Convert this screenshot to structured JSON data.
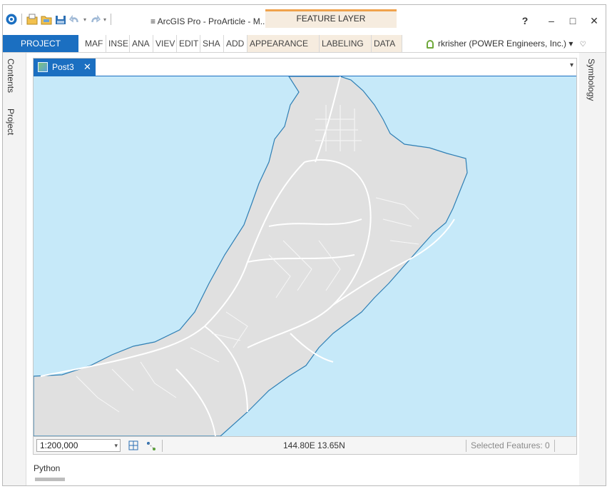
{
  "titlebar": {
    "title": "≡ ArcGIS Pro - ProArticle - M...",
    "context_tab": "FEATURE LAYER",
    "help": "?",
    "minimize": "–",
    "maximize": "□",
    "close": "✕"
  },
  "ribbon": {
    "project_tab": "PROJECT",
    "tabs": [
      "MAF",
      "INSE",
      "ANA",
      "VIEV",
      "EDIT",
      "SHA",
      "ADD"
    ],
    "context_tabs": [
      "APPEARANCE",
      "LABELING",
      "DATA"
    ],
    "user": "rkrisher (POWER Engineers, Inc.) ▾",
    "user_extra": "♡"
  },
  "left_pane": {
    "contents": "Contents",
    "project": "Project"
  },
  "right_pane": {
    "symbology": "Symbology"
  },
  "map_view": {
    "tab_name": "Post3",
    "tab_close": "✕",
    "tab_menu": "▾"
  },
  "statusbar": {
    "scale": "1:200,000",
    "scale_dd": "▾",
    "coordinates": "144.80E 13.65N",
    "selected": "Selected Features: 0"
  },
  "bottom": {
    "python": "Python"
  },
  "colors": {
    "accent": "#1b6fc1",
    "water": "#c6e9f9",
    "land": "#e0e0e0",
    "coast": "#2f7fb4",
    "context": "#f6ecdf"
  },
  "icons": [
    "arcgis-logo-icon",
    "new-project-icon",
    "open-project-icon",
    "save-project-icon",
    "undo-icon",
    "redo-icon",
    "user-icon",
    "explore-icon",
    "snapping-icon"
  ]
}
